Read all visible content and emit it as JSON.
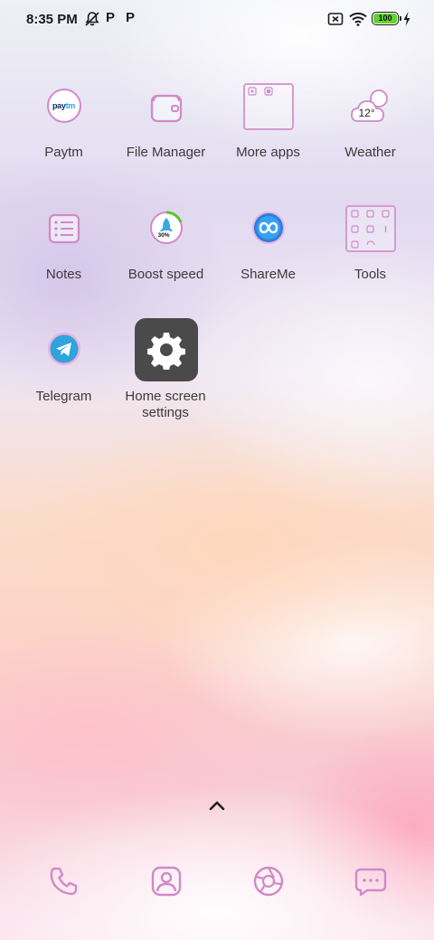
{
  "status_bar": {
    "time": "8:35 PM",
    "notif_p1": "P",
    "notif_p2": "P",
    "battery_level": "100",
    "battery_color": "#5fd42c",
    "icons": [
      "bell-off-icon",
      "sim-off-icon",
      "wifi-icon",
      "battery-icon",
      "charging-bolt-icon"
    ]
  },
  "apps": [
    {
      "label": "Paytm",
      "icon": "paytm-icon"
    },
    {
      "label": "File Manager",
      "icon": "folder-icon"
    },
    {
      "label": "More apps",
      "icon": "folder-grid-icon"
    },
    {
      "label": "Weather",
      "icon": "weather-cloud-icon",
      "temp": "12°"
    },
    {
      "label": "Notes",
      "icon": "notes-icon"
    },
    {
      "label": "Boost speed",
      "icon": "rocket-icon",
      "percent": "30%"
    },
    {
      "label": "ShareMe",
      "icon": "infinity-icon"
    },
    {
      "label": "Tools",
      "icon": "folder-grid-icon"
    },
    {
      "label": "Telegram",
      "icon": "telegram-icon"
    },
    {
      "label": "Home screen settings",
      "icon": "gear-icon"
    }
  ],
  "paytm_logo": {
    "part1": "pay",
    "part2": "tm"
  },
  "dock": [
    "phone-icon",
    "contacts-icon",
    "browser-icon",
    "messages-icon"
  ],
  "accent_color": "#d488cc"
}
